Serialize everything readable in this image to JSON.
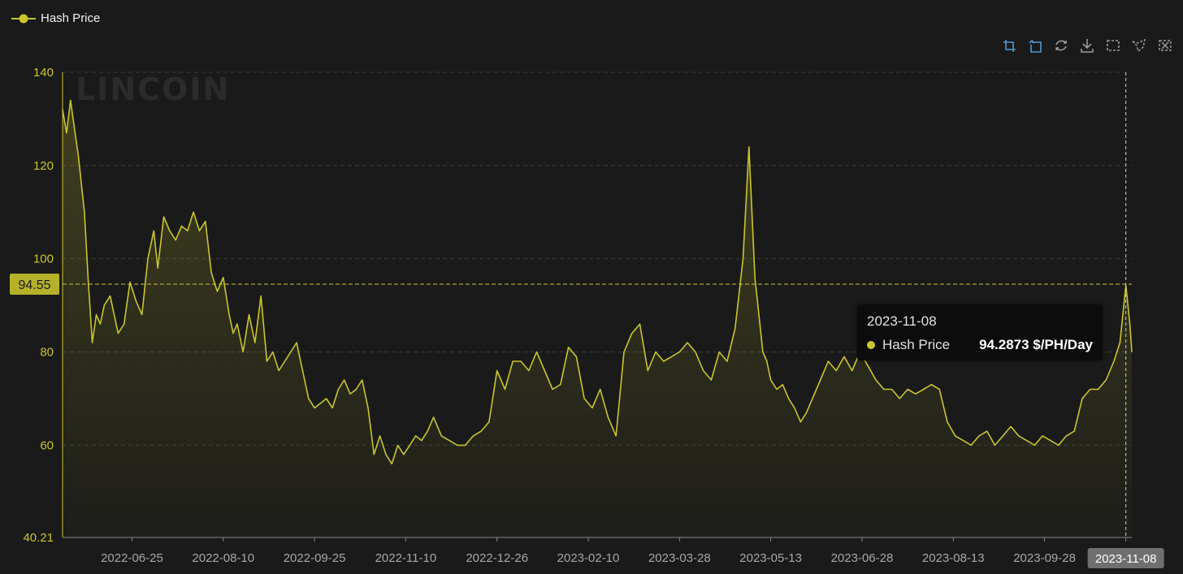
{
  "legend": {
    "label": "Hash Price"
  },
  "watermark": {
    "text": "LINCOIN"
  },
  "toolbar": {
    "icons": [
      "zoom-icon",
      "zoom-reset-icon",
      "restore-icon",
      "download-icon",
      "select-rect-icon",
      "lasso-icon",
      "clear-select-icon"
    ]
  },
  "colors": {
    "series": "#c9c62f",
    "accent": "#4a9ad4",
    "background": "#1a1a1a",
    "grid": "#3a3a3a"
  },
  "tooltip": {
    "date": "2023-11-08",
    "series": "Hash Price",
    "value": "94.2873 $/PH/Day"
  },
  "chart_data": {
    "type": "area",
    "title": "",
    "xlabel": "",
    "ylabel": "",
    "ylim": [
      40.21,
      140
    ],
    "y_ticks": [
      "140",
      "120",
      "100",
      "80",
      "60",
      "40.21"
    ],
    "y_tick_values": [
      140,
      120,
      100,
      80,
      60,
      40.21
    ],
    "x_range": [
      "2022-05-21",
      "2023-11-11"
    ],
    "x_ticks": [
      "2022-06-25",
      "2022-08-10",
      "2022-09-25",
      "2022-11-10",
      "2022-12-26",
      "2023-02-10",
      "2023-03-28",
      "2023-05-13",
      "2023-06-28",
      "2023-08-13",
      "2023-09-28",
      "2023-11-08"
    ],
    "highlight_x_label": "2023-11-08",
    "crosshair_y_label": "94.55",
    "crosshair_y": 94.55,
    "grid": true,
    "legend_position": "top-left",
    "series": [
      {
        "name": "Hash Price",
        "x": [
          "2022-05-21",
          "2022-05-23",
          "2022-05-25",
          "2022-05-27",
          "2022-05-29",
          "2022-06-01",
          "2022-06-03",
          "2022-06-05",
          "2022-06-07",
          "2022-06-09",
          "2022-06-11",
          "2022-06-14",
          "2022-06-16",
          "2022-06-18",
          "2022-06-21",
          "2022-06-24",
          "2022-06-27",
          "2022-06-30",
          "2022-07-03",
          "2022-07-06",
          "2022-07-08",
          "2022-07-11",
          "2022-07-14",
          "2022-07-17",
          "2022-07-20",
          "2022-07-23",
          "2022-07-26",
          "2022-07-29",
          "2022-08-01",
          "2022-08-04",
          "2022-08-07",
          "2022-08-10",
          "2022-08-13",
          "2022-08-15",
          "2022-08-17",
          "2022-08-20",
          "2022-08-23",
          "2022-08-26",
          "2022-08-29",
          "2022-09-01",
          "2022-09-04",
          "2022-09-07",
          "2022-09-10",
          "2022-09-13",
          "2022-09-16",
          "2022-09-19",
          "2022-09-22",
          "2022-09-25",
          "2022-09-28",
          "2022-10-01",
          "2022-10-04",
          "2022-10-07",
          "2022-10-10",
          "2022-10-13",
          "2022-10-16",
          "2022-10-19",
          "2022-10-22",
          "2022-10-25",
          "2022-10-28",
          "2022-10-31",
          "2022-11-03",
          "2022-11-06",
          "2022-11-09",
          "2022-11-12",
          "2022-11-15",
          "2022-11-18",
          "2022-11-21",
          "2022-11-24",
          "2022-11-28",
          "2022-12-02",
          "2022-12-06",
          "2022-12-10",
          "2022-12-14",
          "2022-12-18",
          "2022-12-22",
          "2022-12-26",
          "2022-12-30",
          "2023-01-03",
          "2023-01-07",
          "2023-01-11",
          "2023-01-15",
          "2023-01-19",
          "2023-01-23",
          "2023-01-27",
          "2023-01-31",
          "2023-02-04",
          "2023-02-08",
          "2023-02-12",
          "2023-02-16",
          "2023-02-20",
          "2023-02-24",
          "2023-02-28",
          "2023-03-04",
          "2023-03-08",
          "2023-03-12",
          "2023-03-16",
          "2023-03-20",
          "2023-03-24",
          "2023-03-28",
          "2023-04-01",
          "2023-04-05",
          "2023-04-09",
          "2023-04-13",
          "2023-04-17",
          "2023-04-21",
          "2023-04-25",
          "2023-04-29",
          "2023-05-02",
          "2023-05-05",
          "2023-05-07",
          "2023-05-09",
          "2023-05-11",
          "2023-05-13",
          "2023-05-16",
          "2023-05-19",
          "2023-05-22",
          "2023-05-25",
          "2023-05-28",
          "2023-05-31",
          "2023-06-03",
          "2023-06-07",
          "2023-06-11",
          "2023-06-15",
          "2023-06-19",
          "2023-06-23",
          "2023-06-27",
          "2023-07-01",
          "2023-07-05",
          "2023-07-09",
          "2023-07-13",
          "2023-07-17",
          "2023-07-21",
          "2023-07-25",
          "2023-07-29",
          "2023-08-02",
          "2023-08-06",
          "2023-08-10",
          "2023-08-14",
          "2023-08-18",
          "2023-08-22",
          "2023-08-26",
          "2023-08-30",
          "2023-09-03",
          "2023-09-07",
          "2023-09-11",
          "2023-09-15",
          "2023-09-19",
          "2023-09-23",
          "2023-09-27",
          "2023-10-01",
          "2023-10-05",
          "2023-10-09",
          "2023-10-13",
          "2023-10-17",
          "2023-10-21",
          "2023-10-25",
          "2023-10-29",
          "2023-11-02",
          "2023-11-05",
          "2023-11-08",
          "2023-11-10",
          "2023-11-11"
        ],
        "values": [
          132,
          127,
          134,
          128,
          122,
          110,
          95,
          82,
          88,
          86,
          90,
          92,
          88,
          84,
          86,
          95,
          91,
          88,
          100,
          106,
          98,
          109,
          106,
          104,
          107,
          106,
          110,
          106,
          108,
          97,
          93,
          96,
          88,
          84,
          86,
          80,
          88,
          82,
          92,
          78,
          80,
          76,
          78,
          80,
          82,
          76,
          70,
          68,
          69,
          70,
          68,
          72,
          74,
          71,
          72,
          74,
          68,
          58,
          62,
          58,
          56,
          60,
          58,
          60,
          62,
          61,
          63,
          66,
          62,
          61,
          60,
          60,
          62,
          63,
          65,
          76,
          72,
          78,
          78,
          76,
          80,
          76,
          72,
          73,
          81,
          79,
          70,
          68,
          72,
          66,
          62,
          80,
          84,
          86,
          76,
          80,
          78,
          79,
          80,
          82,
          80,
          76,
          74,
          80,
          78,
          85,
          100,
          124,
          96,
          88,
          80,
          78,
          74,
          72,
          73,
          70,
          68,
          65,
          67,
          70,
          74,
          78,
          76,
          79,
          76,
          80,
          77,
          74,
          72,
          72,
          70,
          72,
          71,
          72,
          73,
          72,
          65,
          62,
          61,
          60,
          62,
          63,
          60,
          62,
          64,
          62,
          61,
          60,
          62,
          61,
          60,
          62,
          63,
          70,
          72,
          72,
          74,
          78,
          82,
          94.3,
          86,
          80
        ]
      }
    ]
  }
}
